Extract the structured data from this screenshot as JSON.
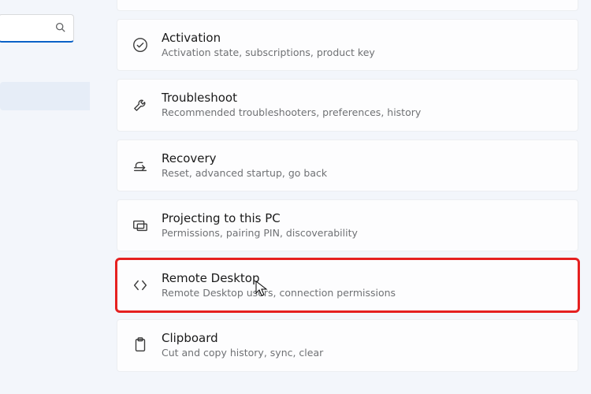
{
  "search": {
    "placeholder": ""
  },
  "items": [
    {
      "title": "Activation",
      "sub": "Activation state, subscriptions, product key"
    },
    {
      "title": "Troubleshoot",
      "sub": "Recommended troubleshooters, preferences, history"
    },
    {
      "title": "Recovery",
      "sub": "Reset, advanced startup, go back"
    },
    {
      "title": "Projecting to this PC",
      "sub": "Permissions, pairing PIN, discoverability"
    },
    {
      "title": "Remote Desktop",
      "sub": "Remote Desktop users, connection permissions"
    },
    {
      "title": "Clipboard",
      "sub": "Cut and copy history, sync, clear"
    }
  ],
  "highlight_index": 4
}
